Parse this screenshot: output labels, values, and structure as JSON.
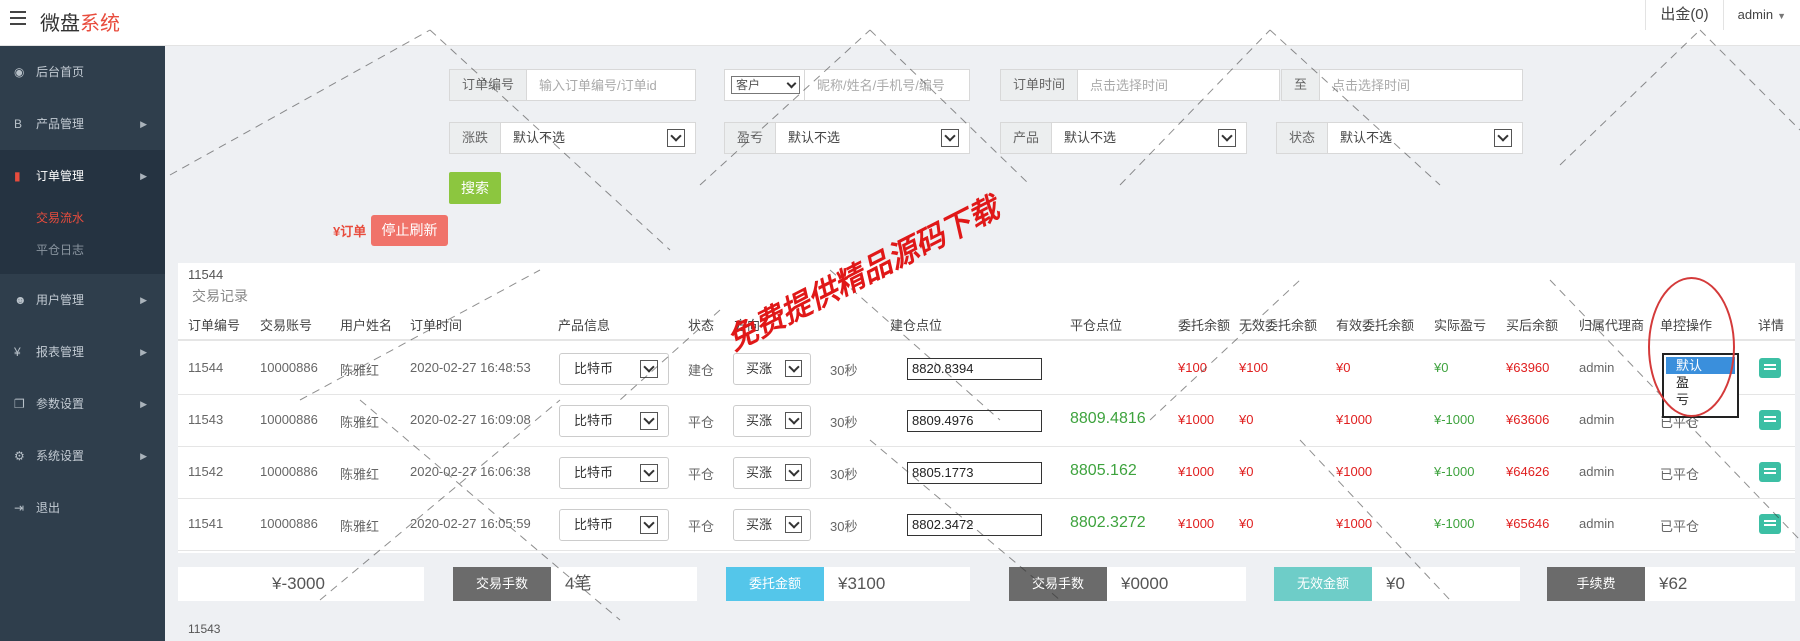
{
  "app": {
    "brand_main": "微盘",
    "brand_accent": "系统"
  },
  "header": {
    "withdraw_label": "出金(0)",
    "user_label": "admin"
  },
  "sidebar": {
    "items": [
      {
        "label": "后台首页",
        "icon": "dashboard-icon",
        "glyph": "◉",
        "has_arrow": false
      },
      {
        "label": "产品管理",
        "icon": "bitcoin-icon",
        "glyph": "B",
        "has_arrow": true
      },
      {
        "label": "订单管理",
        "icon": "orders-icon",
        "glyph": "▮",
        "has_arrow": true
      },
      {
        "label": "用户管理",
        "icon": "user-icon",
        "glyph": "☻",
        "has_arrow": true
      },
      {
        "label": "报表管理",
        "icon": "yen-icon",
        "glyph": "¥",
        "has_arrow": true
      },
      {
        "label": "参数设置",
        "icon": "params-icon",
        "glyph": "❐",
        "has_arrow": true
      },
      {
        "label": "系统设置",
        "icon": "gears-icon",
        "glyph": "⚙",
        "has_arrow": true
      },
      {
        "label": "退出",
        "icon": "logout-icon",
        "glyph": "⇥",
        "has_arrow": false
      }
    ],
    "sub_items": [
      "交易流水",
      "平仓日志"
    ]
  },
  "filters": {
    "order_no_label": "订单编号",
    "order_no_placeholder": "输入订单编号/订单id",
    "customer_select": "客户",
    "customer_placeholder": "昵称/姓名/手机号/编号",
    "order_time_label": "订单时间",
    "time_start_placeholder": "点击选择时间",
    "to_label": "至",
    "time_end_placeholder": "点击选择时间",
    "rise_fall_label": "涨跌",
    "pl_label": "盈亏",
    "product_label": "产品",
    "status_label": "状态",
    "default_option": "默认不选",
    "search_button": "搜索"
  },
  "toolbar": {
    "order_tag": "¥订单",
    "stop_refresh": "停止刷新"
  },
  "panel": {
    "id_text": "11544",
    "title": "交易记录",
    "columns": [
      "订单编号",
      "交易账号",
      "用户姓名",
      "订单时间",
      "产品信息",
      "状态",
      "方向",
      "建仓点位",
      "平仓点位",
      "委托余额",
      "无效委托余额",
      "有效委托余额",
      "实际盈亏",
      "买后余额",
      "归属代理商",
      "单控操作",
      "详情"
    ],
    "rows": [
      {
        "order_no": "11544",
        "account": "10000886",
        "name": "陈雅红",
        "time": "2020-02-27 16:48:53",
        "product": "比特币",
        "status": "建仓",
        "direction": "买涨",
        "period": "30秒",
        "open_price": "8820.8394",
        "close_price": "",
        "entrust": "¥100",
        "invalid": "¥100",
        "valid": "¥0",
        "pl": "¥0",
        "balance": "¥63960",
        "agent": "admin",
        "ctrl": ""
      },
      {
        "order_no": "11543",
        "account": "10000886",
        "name": "陈雅红",
        "time": "2020-02-27 16:09:08",
        "product": "比特币",
        "status": "平仓",
        "direction": "买涨",
        "period": "30秒",
        "open_price": "8809.4976",
        "close_price": "8809.4816",
        "entrust": "¥1000",
        "invalid": "¥0",
        "valid": "¥1000",
        "pl": "¥-1000",
        "balance": "¥63606",
        "agent": "admin",
        "ctrl": "已平仓"
      },
      {
        "order_no": "11542",
        "account": "10000886",
        "name": "陈雅红",
        "time": "2020-02-27 16:06:38",
        "product": "比特币",
        "status": "平仓",
        "direction": "买涨",
        "period": "30秒",
        "open_price": "8805.1773",
        "close_price": "8805.162",
        "entrust": "¥1000",
        "invalid": "¥0",
        "valid": "¥1000",
        "pl": "¥-1000",
        "balance": "¥64626",
        "agent": "admin",
        "ctrl": "已平仓"
      },
      {
        "order_no": "11541",
        "account": "10000886",
        "name": "陈雅红",
        "time": "2020-02-27 16:05:59",
        "product": "比特币",
        "status": "平仓",
        "direction": "买涨",
        "period": "30秒",
        "open_price": "8802.3472",
        "close_price": "8802.3272",
        "entrust": "¥1000",
        "invalid": "¥0",
        "valid": "¥1000",
        "pl": "¥-1000",
        "balance": "¥65646",
        "agent": "admin",
        "ctrl": "已平仓"
      }
    ],
    "ctrl_options": [
      "默认",
      "盈",
      "亏"
    ]
  },
  "summary": [
    {
      "label": "",
      "value": "¥-3000",
      "color": ""
    },
    {
      "label": "交易手数",
      "value": "4笔",
      "color": "gray"
    },
    {
      "label": "委托金额",
      "value": "¥3100",
      "color": "blue"
    },
    {
      "label": "交易手数",
      "value": "¥0000",
      "color": "gray"
    },
    {
      "label": "无效金额",
      "value": "¥0",
      "color": "teal"
    },
    {
      "label": "手续费",
      "value": "¥62",
      "color": "gray"
    }
  ],
  "bottom_id": "11543",
  "watermark": "免费提供精品源码下载",
  "colors": {
    "accent": "#e84c3d",
    "sidebar": "#2f3e4c",
    "search": "#8cc63f",
    "detail": "#3cbfa4"
  }
}
